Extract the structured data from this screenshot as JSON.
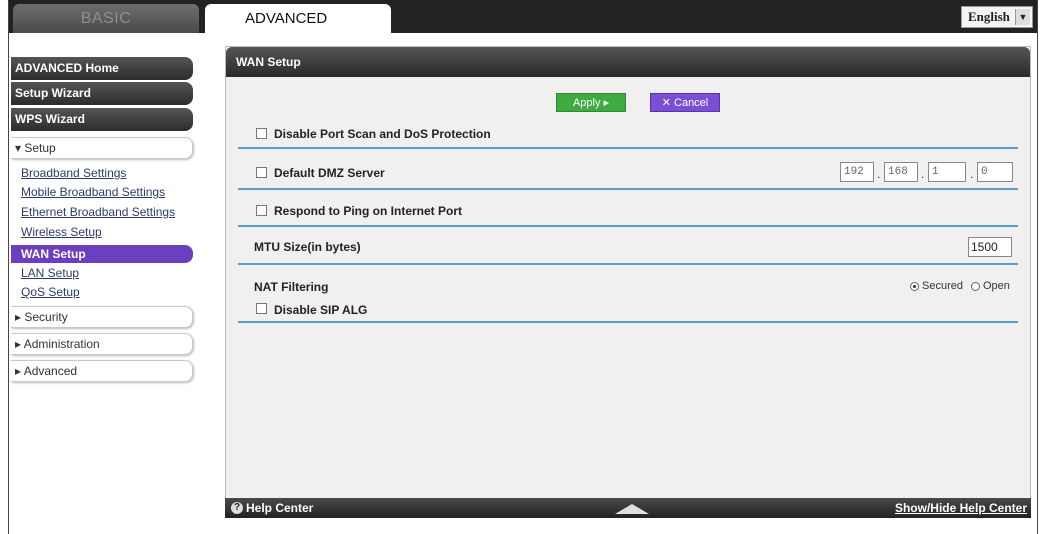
{
  "top_tabs": {
    "basic": "BASIC",
    "advanced": "ADVANCED"
  },
  "language": {
    "value": "English"
  },
  "sidebar": {
    "advanced_home": "ADVANCED Home",
    "setup_wizard": "Setup Wizard",
    "wps_wizard": "WPS Wizard",
    "setup": "▾ Setup",
    "setup_items": [
      "Broadband Settings",
      "Mobile Broadband Settings",
      "Ethernet Broadband Settings",
      "Wireless Setup",
      "WAN Setup",
      "LAN Setup",
      "QoS Setup"
    ],
    "security": "▸ Security",
    "administration": "▸ Administration",
    "advanced": "▸ Advanced"
  },
  "main": {
    "title": "WAN Setup",
    "apply": "Apply ▸",
    "cancel": "✕ Cancel",
    "disable_port_scan": "Disable Port Scan and DoS Protection",
    "default_dmz": "Default DMZ Server",
    "dmz_ip": [
      "192",
      "168",
      "1",
      "0"
    ],
    "respond_ping": "Respond to Ping on Internet Port",
    "mtu_label": "MTU Size(in bytes)",
    "mtu_value": "1500",
    "nat_filtering": "NAT Filtering",
    "nat_secured": "Secured",
    "nat_open": "Open",
    "disable_sip": "Disable SIP ALG"
  },
  "footer": {
    "help_center": "Help Center",
    "show_hide": "Show/Hide Help Center"
  }
}
